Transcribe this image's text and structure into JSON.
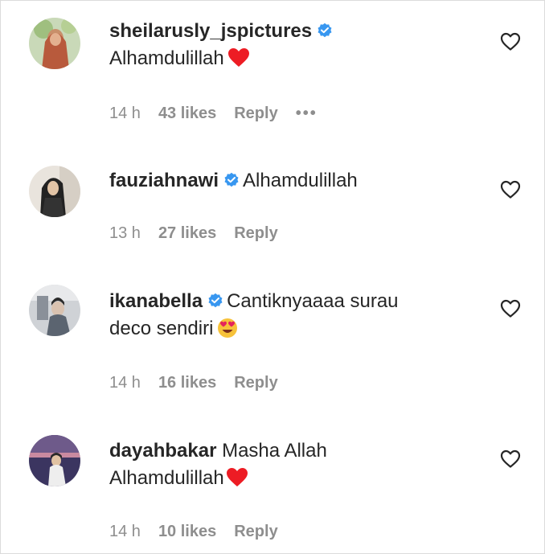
{
  "comments": [
    {
      "username": "sheilarusly_jspictures",
      "verified": true,
      "text": "Alhamdulillah",
      "emoji": "red-heart",
      "time": "14 h",
      "likes": "43 likes",
      "reply": "Reply",
      "more": "•••"
    },
    {
      "username": "fauziahnawi",
      "verified": true,
      "text": "Alhamdulillah",
      "time": "13 h",
      "likes": "27 likes",
      "reply": "Reply"
    },
    {
      "username": "ikanabella",
      "verified": true,
      "text_line1": "Cantiknyaaaa surau",
      "text_line2": "deco sendiri",
      "emoji": "heart-eyes",
      "time": "14 h",
      "likes": "16 likes",
      "reply": "Reply"
    },
    {
      "username": "dayahbakar",
      "verified": false,
      "text_line1": "Masha Allah",
      "text_line2": "Alhamdulillah",
      "emoji": "red-heart",
      "time": "14 h",
      "likes": "10 likes",
      "reply": "Reply"
    }
  ],
  "colors": {
    "text": "#262626",
    "meta": "#8e8e8e",
    "verified": "#3897f0",
    "heart_emoji": "#ed1c24"
  }
}
